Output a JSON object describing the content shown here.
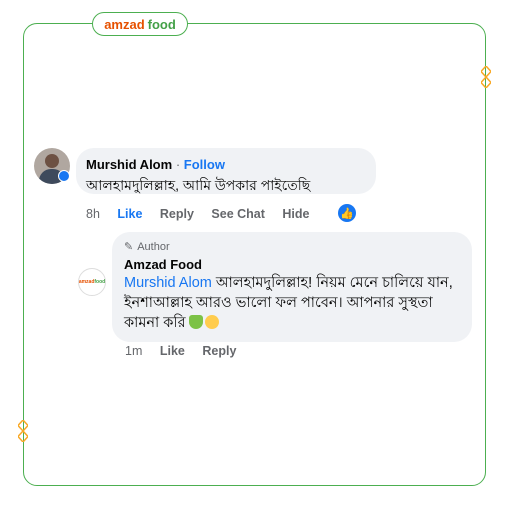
{
  "brand": {
    "part1": "amzad",
    "part2": "food"
  },
  "comment": {
    "name": "Murshid Alom",
    "separator": "·",
    "follow_label": "Follow",
    "text": "আলহামদুলিল্লাহ, আমি উপকার পাইতেছি",
    "time": "8h",
    "like_label": "Like",
    "reply_label": "Reply",
    "see_chat_label": "See Chat",
    "hide_label": "Hide",
    "reaction_icon": "like-reaction-icon"
  },
  "reply": {
    "author_label": "Author",
    "name": "Amzad Food",
    "mention": "Murshid Alom",
    "text": "আলহামদুলিল্লাহ! নিয়ম মেনে চালিয়ে যান, ইনশাআল্লাহ আরও ভালো ফল পাবেন। আপনার সুস্থতা কামনা করি",
    "time": "1m",
    "like_label": "Like",
    "reply_label": "Reply",
    "avatar_text1": "amzad",
    "avatar_text2": "food"
  },
  "colors": {
    "accent": "#4caf50",
    "brand_orange": "#e65100",
    "link": "#1877f2"
  }
}
